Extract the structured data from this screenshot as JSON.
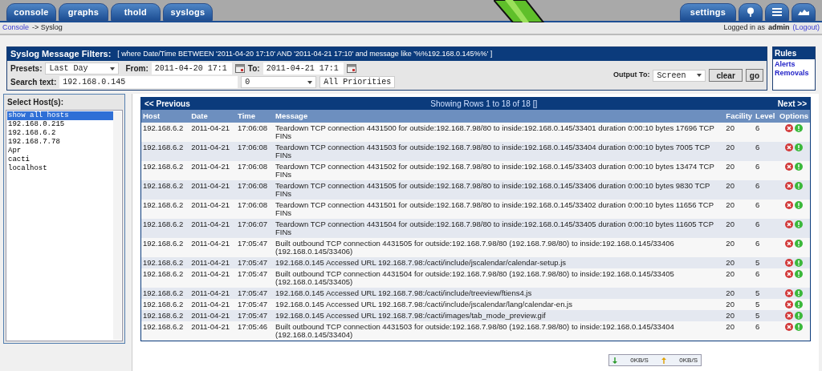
{
  "tabs_left": [
    {
      "label": "console"
    },
    {
      "label": "graphs"
    },
    {
      "label": "thold"
    },
    {
      "label": "syslogs"
    }
  ],
  "tabs_right": [
    {
      "kind": "text",
      "label": "settings"
    },
    {
      "kind": "tree"
    },
    {
      "kind": "list"
    },
    {
      "kind": "graph"
    }
  ],
  "breadcrumb": {
    "link": "Console",
    "rest": "-> Syslog"
  },
  "login": {
    "prefix": "Logged in as",
    "user": "admin",
    "logout": "(Logout)"
  },
  "filters": {
    "title": "Syslog Message Filters:",
    "query": "[ where Date/Time BETWEEN '2011-04-20 17:10' AND '2011-04-21 17:10' and message like '%%192.168.0.145%%' ]",
    "presets_label": "Presets:",
    "presets_value": "Last Day",
    "from_label": "From:",
    "from_value": "2011-04-20 17:1",
    "to_label": "To:",
    "to_value": "2011-04-21 17:1",
    "search_label": "Search text:",
    "search_value": "192.168.0.145",
    "facility_value": "0",
    "priority_value": "All Priorities",
    "output_label": "Output To:",
    "output_value": "Screen",
    "clear": "clear",
    "go": "go"
  },
  "rules": {
    "title": "Rules",
    "links": [
      "Alerts",
      "Removals"
    ]
  },
  "hosts": {
    "title": "Select Host(s):",
    "items": [
      {
        "label": "show all hosts",
        "selected": true
      },
      {
        "label": "192.168.0.215",
        "selected": false
      },
      {
        "label": "192.168.6.2",
        "selected": false
      },
      {
        "label": "192.168.7.78",
        "selected": false
      },
      {
        "label": "Apr",
        "selected": false
      },
      {
        "label": "cacti",
        "selected": false
      },
      {
        "label": "localhost",
        "selected": false
      }
    ]
  },
  "table": {
    "previous": "<< Previous",
    "showing": "Showing Rows 1 to 18 of 18 []",
    "next": "Next >>",
    "columns": [
      "Host",
      "Date",
      "Time",
      "Message",
      "Facility",
      "Level",
      "Options"
    ],
    "rows": [
      [
        "192.168.6.2",
        "2011-04-21",
        "17:06:08",
        "Teardown TCP connection 4431500 for outside:192.168.7.98/80 to inside:192.168.0.145/33401 duration 0:00:10 bytes 17696 TCP FINs",
        "20",
        "6"
      ],
      [
        "192.168.6.2",
        "2011-04-21",
        "17:06:08",
        "Teardown TCP connection 4431503 for outside:192.168.7.98/80 to inside:192.168.0.145/33404 duration 0:00:10 bytes 7005 TCP FINs",
        "20",
        "6"
      ],
      [
        "192.168.6.2",
        "2011-04-21",
        "17:06:08",
        "Teardown TCP connection 4431502 for outside:192.168.7.98/80 to inside:192.168.0.145/33403 duration 0:00:10 bytes 13474 TCP FINs",
        "20",
        "6"
      ],
      [
        "192.168.6.2",
        "2011-04-21",
        "17:06:08",
        "Teardown TCP connection 4431505 for outside:192.168.7.98/80 to inside:192.168.0.145/33406 duration 0:00:10 bytes 9830 TCP FINs",
        "20",
        "6"
      ],
      [
        "192.168.6.2",
        "2011-04-21",
        "17:06:08",
        "Teardown TCP connection 4431501 for outside:192.168.7.98/80 to inside:192.168.0.145/33402 duration 0:00:10 bytes 11656 TCP FINs",
        "20",
        "6"
      ],
      [
        "192.168.6.2",
        "2011-04-21",
        "17:06:07",
        "Teardown TCP connection 4431504 for outside:192.168.7.98/80 to inside:192.168.0.145/33405 duration 0:00:10 bytes 11605 TCP FINs",
        "20",
        "6"
      ],
      [
        "192.168.6.2",
        "2011-04-21",
        "17:05:47",
        "Built outbound TCP connection 4431505 for outside:192.168.7.98/80 (192.168.7.98/80) to inside:192.168.0.145/33406 (192.168.0.145/33406)",
        "20",
        "6"
      ],
      [
        "192.168.6.2",
        "2011-04-21",
        "17:05:47",
        "192.168.0.145 Accessed URL 192.168.7.98:/cacti/include/jscalendar/calendar-setup.js",
        "20",
        "5"
      ],
      [
        "192.168.6.2",
        "2011-04-21",
        "17:05:47",
        "Built outbound TCP connection 4431504 for outside:192.168.7.98/80 (192.168.7.98/80) to inside:192.168.0.145/33405 (192.168.0.145/33405)",
        "20",
        "6"
      ],
      [
        "192.168.6.2",
        "2011-04-21",
        "17:05:47",
        "192.168.0.145 Accessed URL 192.168.7.98:/cacti/include/treeview/ftiens4.js",
        "20",
        "5"
      ],
      [
        "192.168.6.2",
        "2011-04-21",
        "17:05:47",
        "192.168.0.145 Accessed URL 192.168.7.98:/cacti/include/jscalendar/lang/calendar-en.js",
        "20",
        "5"
      ],
      [
        "192.168.6.2",
        "2011-04-21",
        "17:05:47",
        "192.168.0.145 Accessed URL 192.168.7.98:/cacti/images/tab_mode_preview.gif",
        "20",
        "5"
      ],
      [
        "192.168.6.2",
        "2011-04-21",
        "17:05:46",
        "Built outbound TCP connection 4431503 for outside:192.168.7.98/80 (192.168.7.98/80) to inside:192.168.0.145/33404 (192.168.0.145/33404)",
        "20",
        "6"
      ]
    ]
  },
  "speed_widget": {
    "down": "0KB/S",
    "up": "0KB/S"
  }
}
